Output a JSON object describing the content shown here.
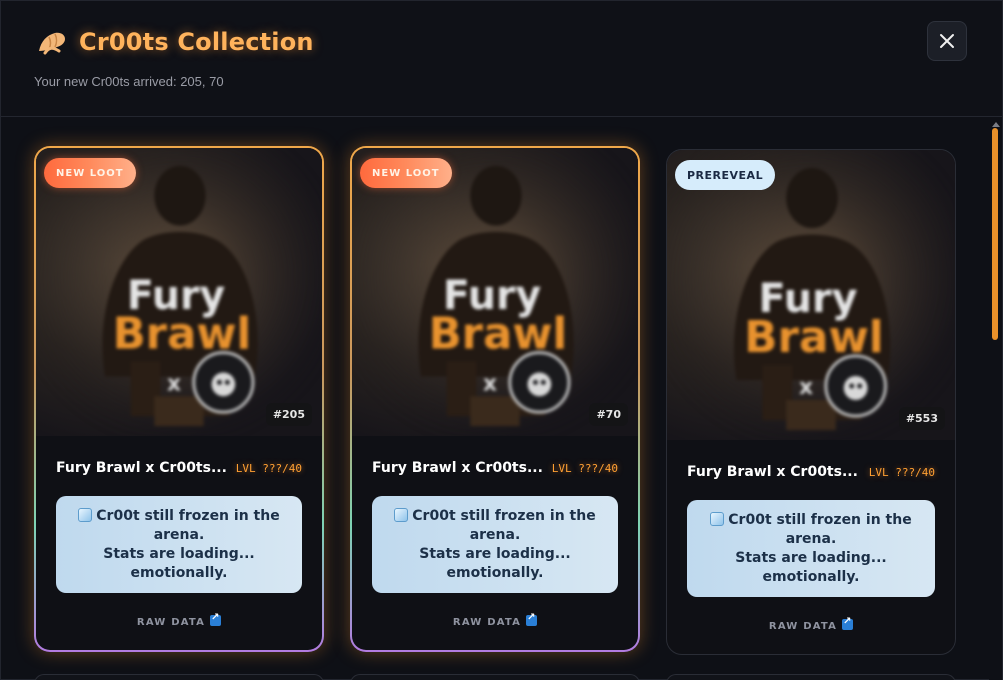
{
  "header": {
    "title": "Cr00ts Collection",
    "subtitle": "Your new Cr00ts arrived: 205, 70",
    "title_icon": "croissant-icon",
    "close_icon": "close-icon",
    "accent_color": "#ffb35c"
  },
  "cards": [
    {
      "badge": "NEW LOOT",
      "number": "#205",
      "name": "Fury Brawl x Cr00ts...",
      "level": "LVL ???/40",
      "status_text": "Cr00t still frozen in the arena. Stats are loading... emotionally.",
      "status_line1": "Cr00t still frozen in the",
      "status_line2": "arena.",
      "status_line3": "Stats are loading...",
      "status_line4": "emotionally.",
      "link": "RAW DATA",
      "art_text_1": "Fury",
      "art_text_2": "Brawl",
      "art_text_3": "x"
    },
    {
      "badge": "NEW LOOT",
      "number": "#70",
      "name": "Fury Brawl x Cr00ts...",
      "level": "LVL ???/40",
      "status_line1": "Cr00t still frozen in the",
      "status_line2": "arena.",
      "status_line3": "Stats are loading...",
      "status_line4": "emotionally.",
      "link": "RAW DATA",
      "art_text_1": "Fury",
      "art_text_2": "Brawl",
      "art_text_3": "x"
    },
    {
      "badge": "PREREVEAL",
      "number": "#553",
      "name": "Fury Brawl x Cr00ts...",
      "level": "LVL ???/40",
      "status_line1": "Cr00t still frozen in the",
      "status_line2": "arena.",
      "status_line3": "Stats are loading...",
      "status_line4": "emotionally.",
      "link": "RAW DATA",
      "art_text_1": "Fury",
      "art_text_2": "Brawl",
      "art_text_3": "x"
    }
  ],
  "colors": {
    "new_loot_badge": "#ff6a3d",
    "prereveal_badge": "#d6ecfb",
    "level_text": "#ffa033",
    "scrollbar": "#e8902a"
  }
}
